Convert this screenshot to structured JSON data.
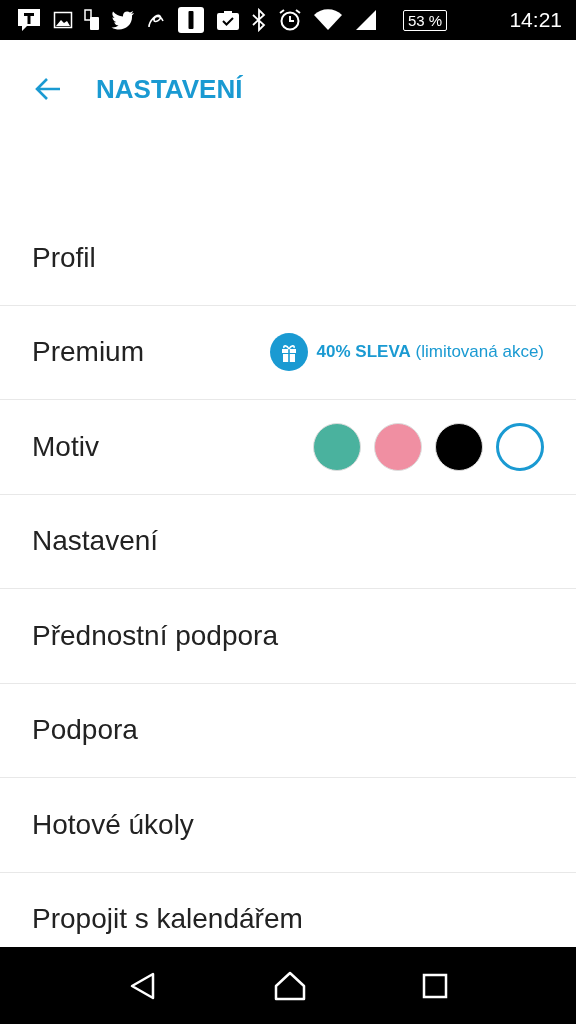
{
  "status_bar": {
    "battery": "53 %",
    "time": "14:21"
  },
  "header": {
    "title": "NASTAVENÍ"
  },
  "rows": [
    {
      "kind": "plain",
      "label": "Profil"
    },
    {
      "kind": "promo",
      "label": "Premium",
      "promo": "**40% SLEVA** (limitovaná akce)"
    },
    {
      "kind": "themes",
      "label": "Motiv",
      "swatches": [
        {
          "color": "#4ab29e",
          "selected": false
        },
        {
          "color": "#f08fa2",
          "selected": false
        },
        {
          "color": "#000000",
          "selected": false
        },
        {
          "color": "#ffffff",
          "selected": true
        }
      ]
    },
    {
      "kind": "plain",
      "label": "Nastavení"
    },
    {
      "kind": "plain",
      "label": "Přednostní podpora"
    },
    {
      "kind": "plain",
      "label": "Podpora"
    },
    {
      "kind": "plain",
      "label": "Hotové úkoly"
    },
    {
      "kind": "plain",
      "label": "Propojit s kalendářem"
    }
  ]
}
